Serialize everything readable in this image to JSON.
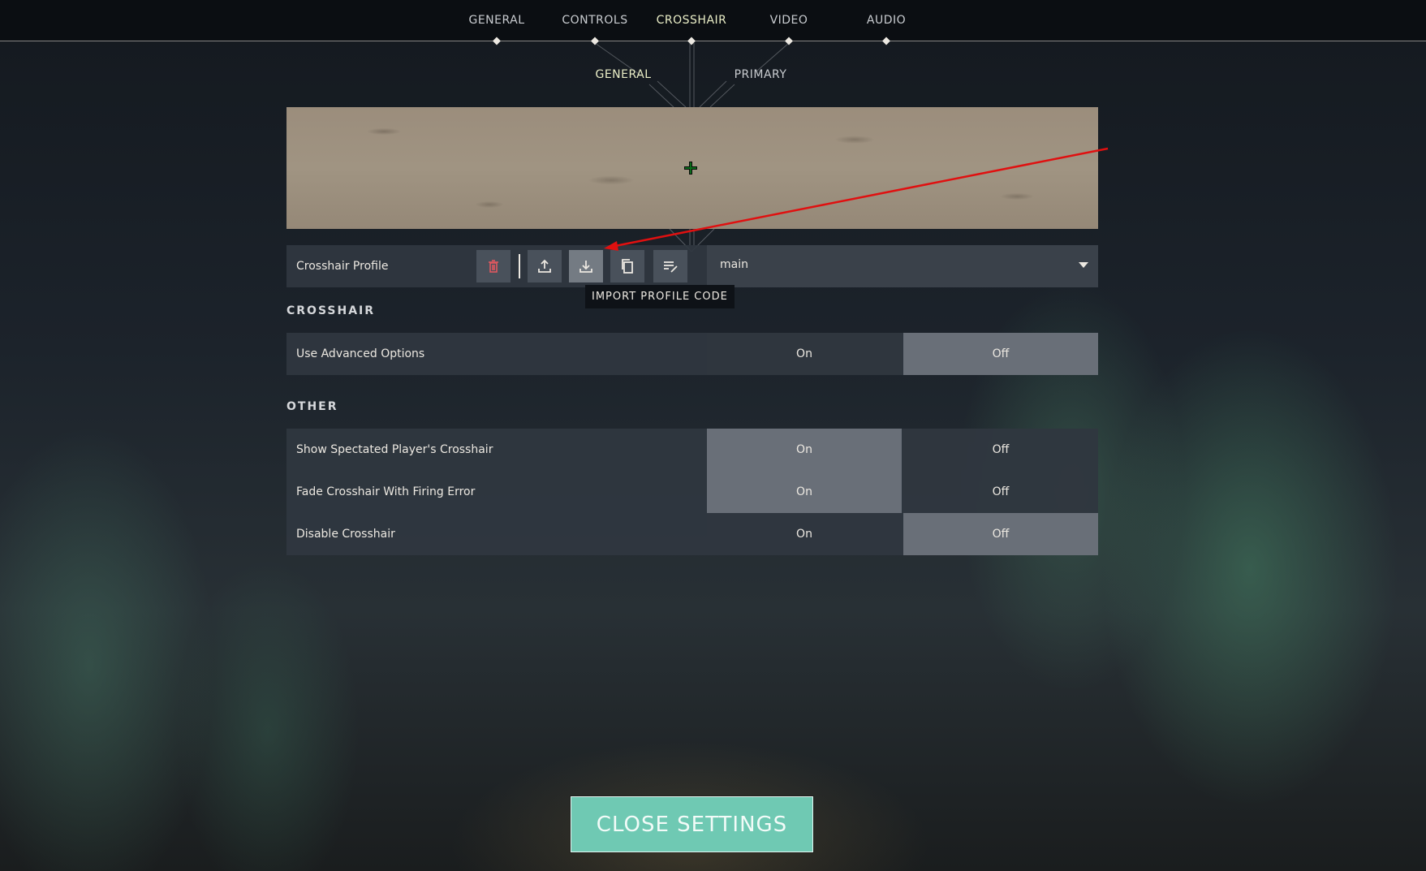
{
  "nav": {
    "tabs": [
      {
        "label": "GENERAL"
      },
      {
        "label": "CONTROLS"
      },
      {
        "label": "CROSSHAIR",
        "active": true
      },
      {
        "label": "VIDEO"
      },
      {
        "label": "AUDIO"
      }
    ],
    "subtabs": [
      {
        "label": "GENERAL",
        "active": true
      },
      {
        "label": "PRIMARY"
      }
    ]
  },
  "profile": {
    "label": "Crosshair Profile",
    "selected": "main",
    "icons": [
      "delete-icon",
      "export-icon",
      "import-icon",
      "copy-icon",
      "rename-icon"
    ],
    "tooltip": "IMPORT PROFILE CODE"
  },
  "sections": {
    "crosshair": {
      "title": "CROSSHAIR",
      "rows": [
        {
          "label": "Use Advanced Options",
          "on": "On",
          "off": "Off",
          "value": "Off"
        }
      ]
    },
    "other": {
      "title": "OTHER",
      "rows": [
        {
          "label": "Show Spectated Player's Crosshair",
          "on": "On",
          "off": "Off",
          "value": "On"
        },
        {
          "label": "Fade Crosshair With Firing Error",
          "on": "On",
          "off": "Off",
          "value": "On"
        },
        {
          "label": "Disable Crosshair",
          "on": "On",
          "off": "Off",
          "value": "Off"
        }
      ]
    }
  },
  "footer": {
    "close_label": "CLOSE SETTINGS"
  },
  "colors": {
    "accent_active": "#eaeec7",
    "close_button": "#6fc9b3",
    "annotation_arrow": "#e01010",
    "crosshair": "#0a6b1a"
  }
}
